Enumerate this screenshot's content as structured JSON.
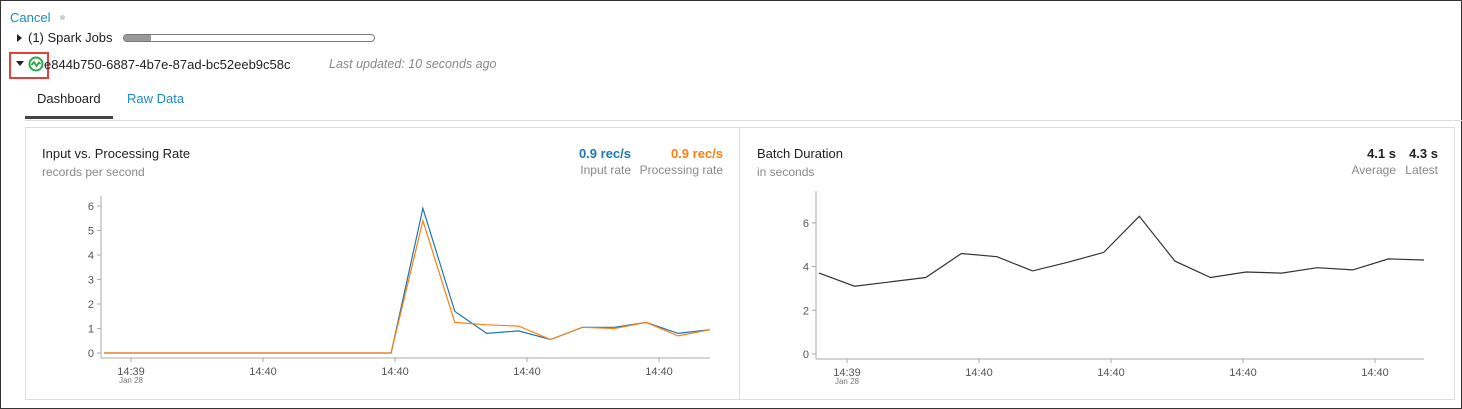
{
  "header": {
    "cancel_label": "Cancel",
    "jobs_label": "(1) Spark Jobs",
    "jobs_progress": 0.11,
    "stream_id": "e844b750-6887-4b7e-87ad-bc52eeb9c58c",
    "last_updated": "Last updated: 10 seconds ago"
  },
  "tabs": [
    {
      "label": "Dashboard",
      "active": true
    },
    {
      "label": "Raw Data",
      "active": false
    }
  ],
  "colors": {
    "input": "#1f77b4",
    "processing": "#ff7f0e",
    "duration": "#333333",
    "accent": "#1a8cc0",
    "highlight": "#e0413a"
  },
  "input_panel": {
    "title": "Input vs. Processing Rate",
    "subtitle": "records per second",
    "input_value": "0.9 rec/s",
    "input_label": "Input rate",
    "processing_value": "0.9 rec/s",
    "processing_label": "Processing rate"
  },
  "duration_panel": {
    "title": "Batch Duration",
    "subtitle": "in seconds",
    "average_value": "4.1 s",
    "average_label": "Average",
    "latest_value": "4.3 s",
    "latest_label": "Latest"
  },
  "chart_data": [
    {
      "type": "line",
      "ylim": [
        0,
        6
      ],
      "yticks": [
        "0",
        "1",
        "2",
        "3",
        "4",
        "5",
        "6"
      ],
      "xticks": [
        {
          "label": "14:39",
          "sub": "Jan 28"
        },
        {
          "label": "14:40",
          "sub": ""
        },
        {
          "label": "14:40",
          "sub": ""
        },
        {
          "label": "14:40",
          "sub": ""
        },
        {
          "label": "14:40",
          "sub": ""
        }
      ],
      "x": [
        0,
        1,
        2,
        3,
        4,
        5,
        6,
        7,
        8,
        9,
        10,
        11,
        12,
        13,
        14,
        15,
        16
      ],
      "series": [
        {
          "name": "Input rate",
          "color": "#1f77b4",
          "values": [
            0,
            0,
            0,
            0,
            0,
            0,
            0,
            0,
            0,
            0,
            5.9,
            1.7,
            0.8,
            0.9,
            0.55,
            1.05,
            1.05,
            1.25,
            0.8,
            0.95
          ]
        },
        {
          "name": "Processing rate",
          "color": "#ff7f0e",
          "values": [
            0,
            0,
            0,
            0,
            0,
            0,
            0,
            0,
            0,
            0,
            5.4,
            1.25,
            1.15,
            1.1,
            0.55,
            1.05,
            1.0,
            1.25,
            0.7,
            0.95
          ]
        }
      ]
    },
    {
      "type": "line",
      "ylim": [
        0,
        7
      ],
      "yticks": [
        "0",
        "2",
        "4",
        "6"
      ],
      "xticks": [
        {
          "label": "14:39",
          "sub": "Jan 28"
        },
        {
          "label": "14:40",
          "sub": ""
        },
        {
          "label": "14:40",
          "sub": ""
        },
        {
          "label": "14:40",
          "sub": ""
        },
        {
          "label": "14:40",
          "sub": ""
        }
      ],
      "series": [
        {
          "name": "Batch Duration",
          "color": "#333333",
          "values": [
            3.7,
            3.1,
            3.3,
            3.5,
            4.6,
            4.45,
            3.8,
            4.2,
            4.65,
            6.3,
            4.25,
            3.5,
            3.75,
            3.7,
            3.95,
            3.85,
            4.35,
            4.3
          ]
        }
      ]
    }
  ]
}
